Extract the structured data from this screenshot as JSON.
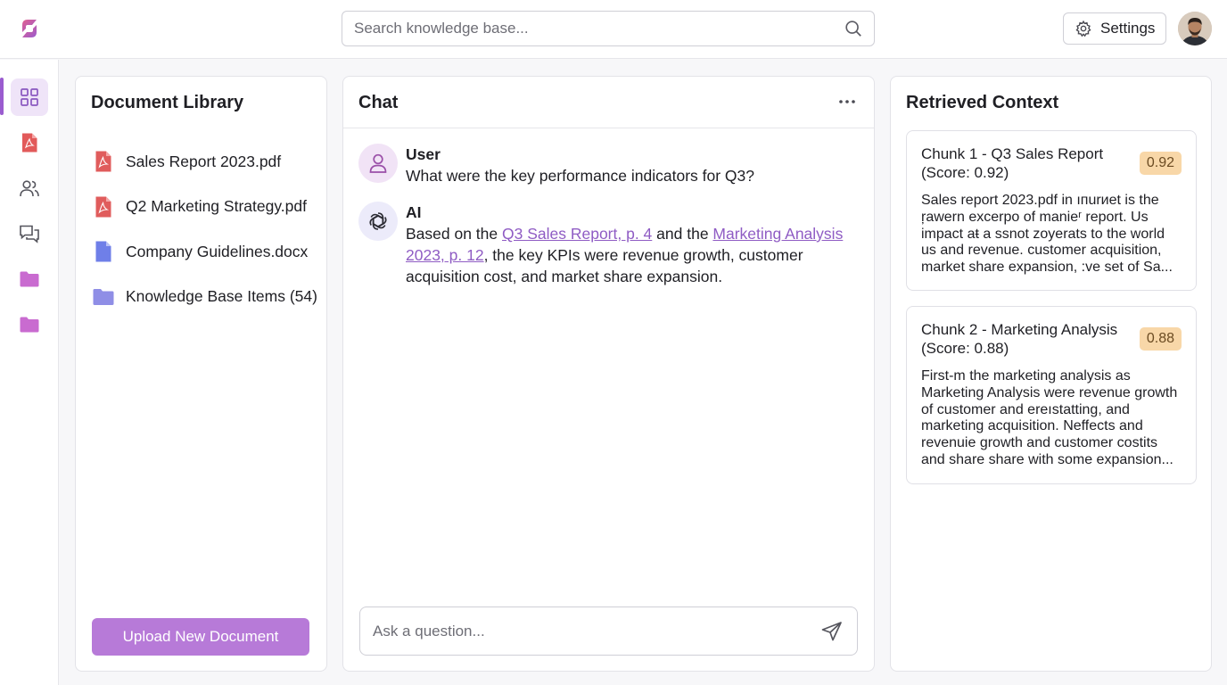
{
  "header": {
    "search_placeholder": "Search knowledge base...",
    "settings_label": "Settings",
    "logo_icon": "brand-logo",
    "search_icon": "search-icon",
    "settings_icon": "gear-icon",
    "avatar": "user-avatar"
  },
  "sidebar": {
    "items": [
      {
        "icon": "grid-icon",
        "active": true
      },
      {
        "icon": "pdf-icon",
        "active": false
      },
      {
        "icon": "users-icon",
        "active": false
      },
      {
        "icon": "chat-icon",
        "active": false
      },
      {
        "icon": "folder-icon",
        "active": false
      },
      {
        "icon": "folder-icon",
        "active": false
      }
    ]
  },
  "library": {
    "title": "Document Library",
    "documents": [
      {
        "name": "Sales Report 2023.pdf",
        "icon": "pdf-icon"
      },
      {
        "name": "Q2 Marketing Strategy.pdf",
        "icon": "pdf-icon"
      },
      {
        "name": "Company Guidelines.docx",
        "icon": "doc-icon"
      },
      {
        "name": "Knowledge Base Items (54)",
        "icon": "folder-icon"
      }
    ],
    "upload_label": "Upload New Document"
  },
  "chat": {
    "title": "Chat",
    "messages": [
      {
        "sender": "User",
        "text": "What were the key performance indicators for Q3?"
      },
      {
        "sender": "AI",
        "text_before": "Based on the ",
        "citation_1": "Q3 Sales Report, p. 4",
        "text_middle": " and the ",
        "citation_2": "Marketing Analysis 2023, p. 12",
        "text_after": ", the key KPIs were revenue growth, customer acquisition cost, and market share expansion."
      }
    ],
    "input_placeholder": "Ask a question..."
  },
  "context": {
    "title": "Retrieved Context",
    "chunks": [
      {
        "title": "Chunk 1 - Q3 Sales Report (Score: 0.92)",
        "score": "0.92",
        "text": "Sales report 2023.pdf in ıпurиet is the ŗawern excerpo of manieʳ report. Us impact aŧ a ssnot zoyerats to the world us and revenue. customer acquisition, market share expansion, :ve set of Sa..."
      },
      {
        "title": "Chunk 2 - Marketing Analysis (Score: 0.88)",
        "score": "0.88",
        "text": "First-m the marketing analysis as Marketing Analysis were revenue growth of customer and ereıstatting, and marketing acquisition. Neffects and revenuie growth and customer costits and share share with some expansion..."
      }
    ],
    "accent_color": "#f8d7a8"
  },
  "colors": {
    "brand": "#b77ad8",
    "accent": "#9a5ccf",
    "link": "#8f5cc4",
    "pdf_red": "#e05c5c",
    "doc_blue": "#6f7fe8",
    "folder_purple": "#c470d0"
  }
}
